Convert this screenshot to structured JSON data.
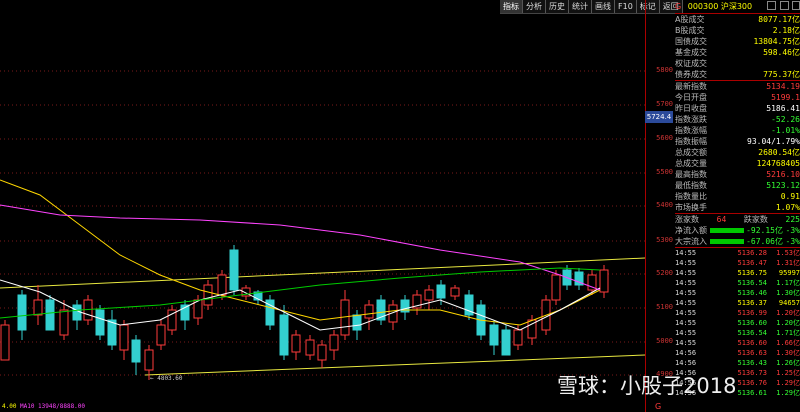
{
  "toolbar": {
    "items": [
      "指标",
      "分析",
      "历史",
      "统计",
      "画线",
      "F10",
      "标记",
      "返回"
    ],
    "active_index": 0
  },
  "axis": {
    "ticks": [
      "5800",
      "5700",
      "5600",
      "5500",
      "5400",
      "5300",
      "5200",
      "5100",
      "5000",
      "4900"
    ],
    "current_price_tag": "5724.4"
  },
  "chart": {
    "low_marker": "4803.60",
    "ma_label": "4.00",
    "ma_info": "MA10  13948/8888.00",
    "colors": {
      "up": "#ff3b3b",
      "down": "#33d0d0",
      "ma5": "#ffffff",
      "ma10": "#ffd700",
      "ma20": "#ff44ff",
      "ma60": "#00cc00",
      "channel": "#e8e840"
    }
  },
  "panel": {
    "header_badge": "G",
    "header_title": "000300 沪深300",
    "stats": [
      {
        "label": "A股成交",
        "value": "8077.17亿"
      },
      {
        "label": "B股成交",
        "value": "2.18亿"
      },
      {
        "label": "国债成交",
        "value": "13804.75亿"
      },
      {
        "label": "基金成交",
        "value": "598.46亿"
      },
      {
        "label": "权证成交",
        "value": ""
      },
      {
        "label": "债券成交",
        "value": "775.37亿"
      }
    ],
    "index": [
      {
        "label": "最新指数",
        "value": "5134.19",
        "color": "#ff3b3b"
      },
      {
        "label": "今日开盘",
        "value": "5199.1",
        "color": "#ff3b3b"
      },
      {
        "label": "昨日收盘",
        "value": "5186.41",
        "color": "#ffffff"
      },
      {
        "label": "指数涨跌",
        "value": "-52.26",
        "color": "#33ff33"
      },
      {
        "label": "指数涨幅",
        "value": "-1.01%",
        "color": "#33ff33"
      },
      {
        "label": "指数振幅",
        "value": "93.04/1.79%",
        "color": "#ffffff"
      },
      {
        "label": "总成交额",
        "value": "2680.54亿",
        "color": "#ffff00"
      },
      {
        "label": "总成交量",
        "value": "124768405",
        "color": "#ffff00"
      },
      {
        "label": "最高指数",
        "value": "5216.10",
        "color": "#ff3b3b"
      },
      {
        "label": "最低指数",
        "value": "5123.12",
        "color": "#33ff33"
      },
      {
        "label": "指数量比",
        "value": "0.91",
        "color": "#ffff00"
      },
      {
        "label": "市场换手",
        "value": "1.07%",
        "color": "#ffff00"
      }
    ],
    "breadth": {
      "up_label": "涨家数",
      "up_count": "64",
      "down_label": "跌家数",
      "down_count": "225"
    },
    "flows": [
      {
        "label": "净流入额",
        "value": "-92.15亿",
        "extra": "-3%"
      },
      {
        "label": "大宗流入",
        "value": "-67.06亿",
        "extra": "-3%"
      }
    ],
    "ticks": [
      {
        "time": "14:55",
        "price": "5136.28",
        "vol": "1.53亿",
        "color": "#ff3b3b"
      },
      {
        "time": "14:55",
        "price": "5136.47",
        "vol": "1.31亿",
        "color": "#ff3b3b"
      },
      {
        "time": "14:55",
        "price": "5136.75",
        "vol": "95997",
        "color": "#ffff00"
      },
      {
        "time": "14:55",
        "price": "5136.54",
        "vol": "1.17亿",
        "color": "#33ff33"
      },
      {
        "time": "14:55",
        "price": "5136.46",
        "vol": "1.30亿",
        "color": "#33ff33"
      },
      {
        "time": "14:55",
        "price": "5136.37",
        "vol": "94657",
        "color": "#ffff00"
      },
      {
        "time": "14:55",
        "price": "5136.99",
        "vol": "1.20亿",
        "color": "#ff3b3b"
      },
      {
        "time": "14:55",
        "price": "5136.60",
        "vol": "1.20亿",
        "color": "#33ff33"
      },
      {
        "time": "14:55",
        "price": "5136.54",
        "vol": "1.71亿",
        "color": "#33ff33"
      },
      {
        "time": "14:55",
        "price": "5136.60",
        "vol": "1.66亿",
        "color": "#ff3b3b"
      },
      {
        "time": "14:56",
        "price": "5136.63",
        "vol": "1.30亿",
        "color": "#ff3b3b"
      },
      {
        "time": "14:56",
        "price": "5136.43",
        "vol": "1.26亿",
        "color": "#33ff33"
      },
      {
        "time": "14:56",
        "price": "5136.73",
        "vol": "1.25亿",
        "color": "#ff3b3b"
      },
      {
        "time": "14:56",
        "price": "5136.76",
        "vol": "1.29亿",
        "color": "#ff3b3b"
      },
      {
        "time": "14:56",
        "price": "5136.61",
        "vol": "1.29亿",
        "color": "#33ff33"
      }
    ]
  },
  "watermark": "雪球：小股子2018",
  "corner_badge": "G"
}
